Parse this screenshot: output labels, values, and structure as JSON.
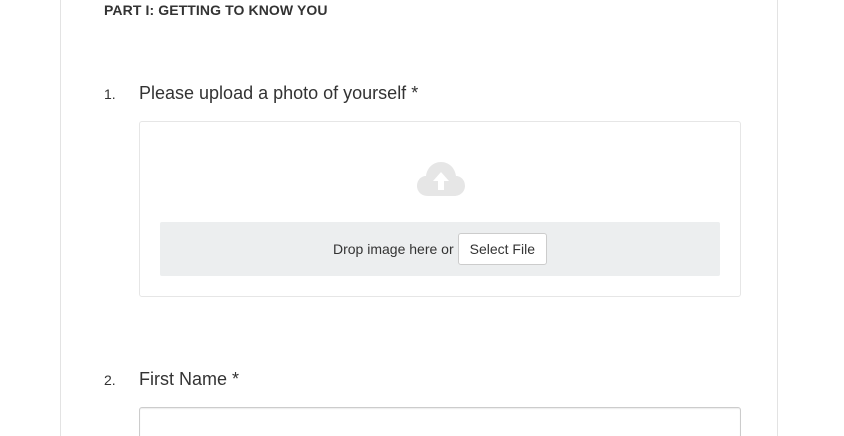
{
  "section": {
    "title": "PART I: GETTING TO KNOW YOU"
  },
  "questions": [
    {
      "number": "1.",
      "label": "Please upload a photo of yourself *",
      "upload": {
        "icon": "cloud-upload-icon",
        "drop_text": "Drop image here or",
        "select_button": "Select File"
      }
    },
    {
      "number": "2.",
      "label": "First Name *",
      "input": {
        "value": "",
        "placeholder": ""
      }
    }
  ],
  "colors": {
    "text": "#333333",
    "drop_strip_bg": "#eceeef",
    "upload_icon": "#e6e6e6",
    "border": "#e6e6e6"
  }
}
